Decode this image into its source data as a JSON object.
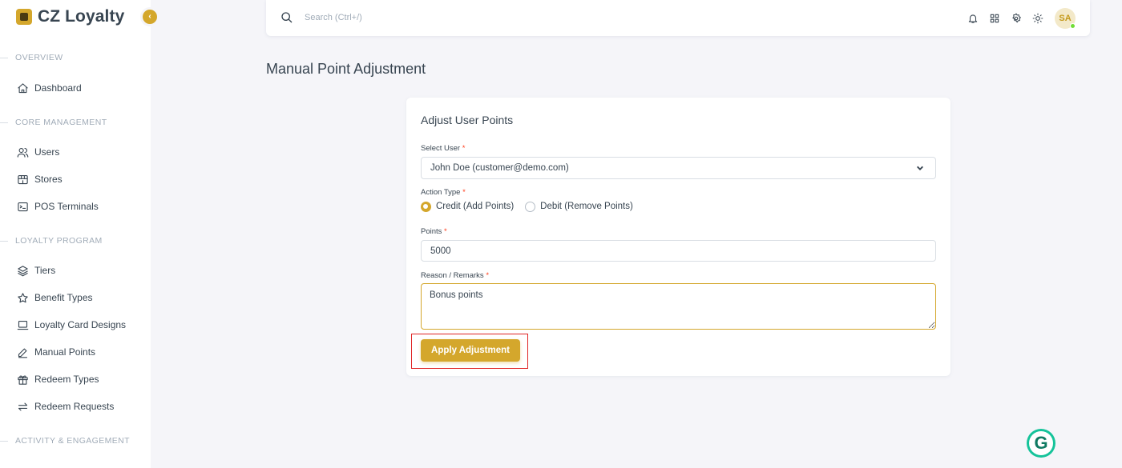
{
  "brand": {
    "name": "CZ Loyalty",
    "collapse_glyph": "‹"
  },
  "sidebar": {
    "sections": [
      {
        "label": "OVERVIEW"
      },
      {
        "label": "CORE MANAGEMENT"
      },
      {
        "label": "LOYALTY PROGRAM"
      },
      {
        "label": "ACTIVITY & ENGAGEMENT"
      }
    ],
    "items": [
      {
        "label": "Dashboard",
        "icon": "home-icon"
      },
      {
        "label": "Users",
        "icon": "users-icon"
      },
      {
        "label": "Stores",
        "icon": "store-icon"
      },
      {
        "label": "POS Terminals",
        "icon": "terminal-icon"
      },
      {
        "label": "Tiers",
        "icon": "layers-icon"
      },
      {
        "label": "Benefit Types",
        "icon": "star-icon"
      },
      {
        "label": "Loyalty Card Designs",
        "icon": "laptop-icon"
      },
      {
        "label": "Manual Points",
        "icon": "pencil-icon"
      },
      {
        "label": "Redeem Types",
        "icon": "gift-icon"
      },
      {
        "label": "Redeem Requests",
        "icon": "arrows-exchange-icon"
      }
    ]
  },
  "topbar": {
    "search_placeholder": "Search (Ctrl+/)",
    "icons": [
      "bell-icon",
      "apps-grid-icon",
      "settings-icon",
      "sun-icon"
    ],
    "avatar_initials": "SA"
  },
  "page": {
    "title": "Manual Point Adjustment"
  },
  "form": {
    "card_title": "Adjust User Points",
    "select_user": {
      "label": "Select User",
      "required_mark": "*",
      "value": "John Doe (customer@demo.com)"
    },
    "action_type": {
      "label": "Action Type",
      "required_mark": "*",
      "options": [
        {
          "label": "Credit (Add Points)",
          "checked": true
        },
        {
          "label": "Debit (Remove Points)",
          "checked": false
        }
      ]
    },
    "points": {
      "label": "Points",
      "required_mark": "*",
      "value": "5000"
    },
    "reason": {
      "label": "Reason / Remarks",
      "required_mark": "*",
      "value": "Bonus points"
    },
    "submit_label": "Apply Adjustment"
  },
  "colors": {
    "accent": "#d4a72c",
    "highlight": "#e02424",
    "required": "#ff3e1d",
    "online": "#71dd37"
  },
  "grammarly": {
    "glyph": "G"
  }
}
